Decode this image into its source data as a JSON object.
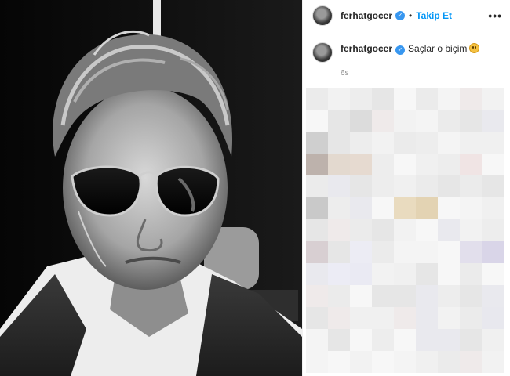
{
  "header": {
    "username": "ferhatgocer",
    "separator": "•",
    "follow_label": "Takip Et",
    "more_label": "•••"
  },
  "caption": {
    "username": "ferhatgocer",
    "text": "Saçlar o biçim",
    "emoji": "grimacing-face-emoji",
    "time": "6s"
  },
  "icons": {
    "verified": "verified-badge-icon",
    "more": "more-options-icon"
  },
  "colors": {
    "accent": "#0095f6",
    "verified": "#3897f0",
    "muted": "#8e8e8e",
    "text": "#262626"
  }
}
